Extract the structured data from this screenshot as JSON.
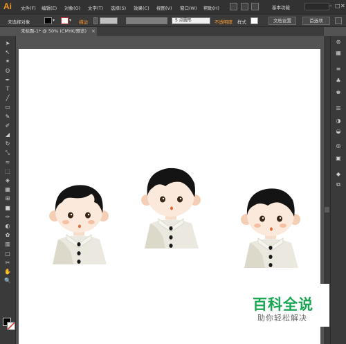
{
  "app": {
    "logo": "Ai",
    "workspace": "基本功能",
    "window_controls": [
      "–",
      "□",
      "✕"
    ]
  },
  "menu": [
    "文件(F)",
    "编辑(E)",
    "对象(O)",
    "文字(T)",
    "选择(S)",
    "效果(C)",
    "视图(V)",
    "窗口(W)",
    "帮助(H)"
  ],
  "control_bar": {
    "selection_status": "未选择对象",
    "stroke_label": "描边",
    "brush_value": "5 点圆形",
    "opacity_label": "不透明度",
    "style_label": "样式",
    "doc_setup_button": "文档设置",
    "preferences_button": "首选项",
    "fill_color": "#000000",
    "accent_color": "#ff9a2e"
  },
  "document_tab": {
    "title": "未标题-1* @ 50% (CMYK/预览)",
    "close": "×"
  },
  "tools": [
    "selection-tool",
    "direct-selection-tool",
    "magic-wand-tool",
    "lasso-tool",
    "pen-tool",
    "type-tool",
    "line-tool",
    "rectangle-tool",
    "paintbrush-tool",
    "pencil-tool",
    "eraser-tool",
    "rotate-tool",
    "scale-tool",
    "width-tool",
    "free-transform-tool",
    "shape-builder-tool",
    "perspective-grid-tool",
    "mesh-tool",
    "gradient-tool",
    "eyedropper-tool",
    "blend-tool",
    "symbol-sprayer-tool",
    "column-graph-tool",
    "artboard-tool",
    "slice-tool",
    "hand-tool",
    "zoom-tool"
  ],
  "tool_glyphs": [
    "➤",
    "↖",
    "✶",
    "ʘ",
    "✒",
    "T",
    "╱",
    "▭",
    "✎",
    "✐",
    "◢",
    "↻",
    "⤡",
    "≈",
    "⬚",
    "◈",
    "▦",
    "⊞",
    "■",
    "✑",
    "◐",
    "✿",
    "▥",
    "▢",
    "✂",
    "✋",
    "🔍"
  ],
  "panels": [
    "⊛",
    "▦",
    "≡",
    "♣",
    "♚",
    "☰",
    "◑",
    "◒",
    "◎",
    "▣",
    "◆",
    "⧉"
  ],
  "watermark": {
    "main": "百科全说",
    "sub": "助你轻松解决",
    "color": "#19a652"
  },
  "characters": [
    "character-front",
    "character-center",
    "character-right"
  ]
}
